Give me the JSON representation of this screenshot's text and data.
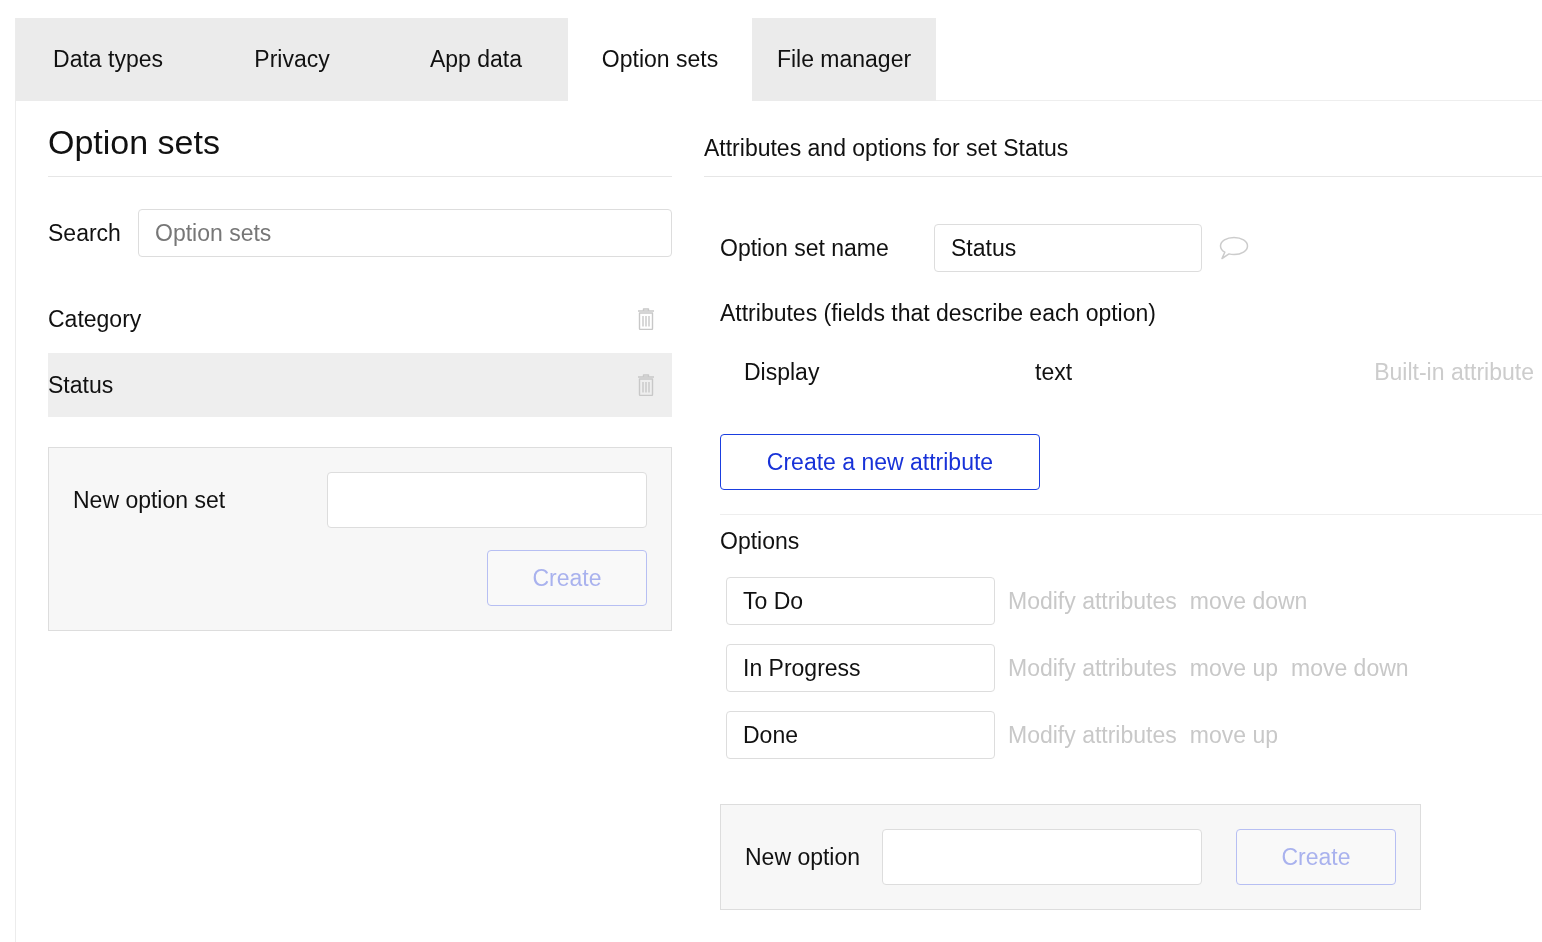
{
  "tabs": [
    {
      "label": "Data types",
      "selected": false
    },
    {
      "label": "Privacy",
      "selected": false
    },
    {
      "label": "App data",
      "selected": false
    },
    {
      "label": "Option sets",
      "selected": true
    },
    {
      "label": "File manager",
      "selected": false
    }
  ],
  "option_sets_panel": {
    "title": "Option sets",
    "search": {
      "label": "Search",
      "placeholder": "Option sets"
    },
    "sets": [
      {
        "name": "Category",
        "selected": false
      },
      {
        "name": "Status",
        "selected": true
      }
    ],
    "new_set": {
      "label": "New option set",
      "button": "Create",
      "disabled": true
    }
  },
  "detail_panel": {
    "title": "Attributes and options for set Status",
    "name_field": {
      "label": "Option set name",
      "value": "Status"
    },
    "attributes_heading": "Attributes (fields that describe each option)",
    "attributes": [
      {
        "name": "Display",
        "type": "text",
        "note": "Built-in attribute"
      }
    ],
    "create_attribute_button": "Create a new attribute",
    "options_heading": "Options",
    "options": [
      {
        "value": "To Do",
        "actions": [
          "Modify attributes",
          "move down"
        ]
      },
      {
        "value": "In Progress",
        "actions": [
          "Modify attributes",
          "move up",
          "move down"
        ]
      },
      {
        "value": "Done",
        "actions": [
          "Modify attributes",
          "move up"
        ]
      }
    ],
    "new_option": {
      "label": "New option",
      "button": "Create",
      "disabled": true
    }
  }
}
